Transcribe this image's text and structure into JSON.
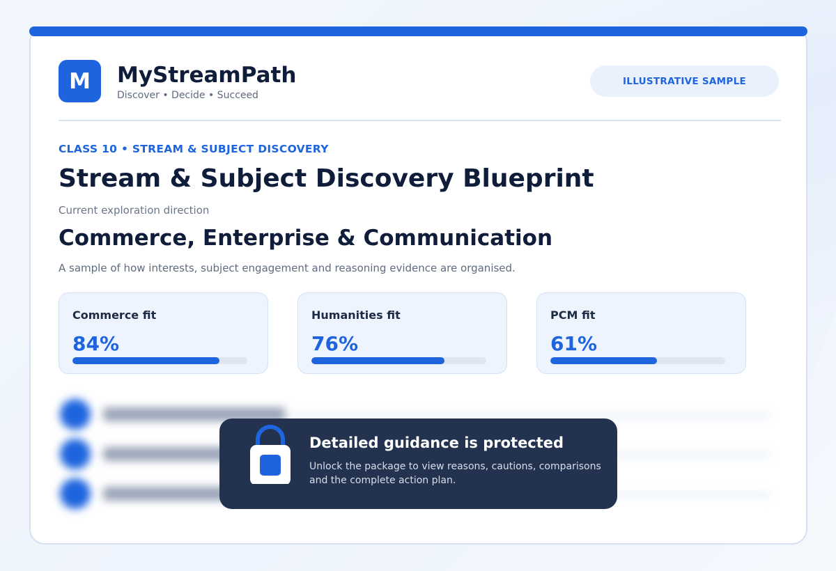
{
  "brand": {
    "logo_letter": "M",
    "name": "MyStreamPath",
    "tagline": "Discover • Decide • Succeed"
  },
  "badge": "ILLUSTRATIVE SAMPLE",
  "eyebrow": "CLASS 10 • STREAM & SUBJECT DISCOVERY",
  "title": "Stream & Subject Discovery Blueprint",
  "direction": {
    "label": "Current exploration direction",
    "value": "Commerce, Enterprise & Communication"
  },
  "description": "A sample of how interests, subject engagement and reasoning evidence are organised.",
  "fits": [
    {
      "label": "Commerce fit",
      "percent_text": "84%",
      "value": 84
    },
    {
      "label": "Humanities fit",
      "percent_text": "76%",
      "value": 76
    },
    {
      "label": "PCM fit",
      "percent_text": "61%",
      "value": 61
    }
  ],
  "locked": {
    "title": "Detailed guidance is protected",
    "subtitle": "Unlock the package to view reasons, cautions, comparisons and the complete action plan.",
    "icon": "lock-icon"
  },
  "colors": {
    "accent": "#1d64de",
    "heading": "#0f1d3a",
    "panel": "#22324f"
  }
}
